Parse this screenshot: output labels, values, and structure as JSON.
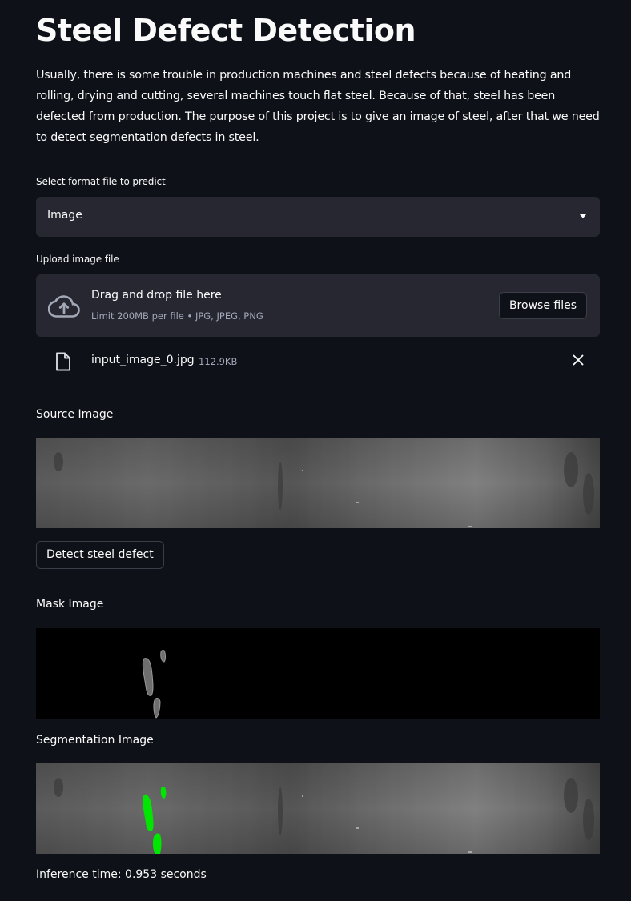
{
  "header": {
    "title": "Steel Defect Detection",
    "description": "Usually, there is some trouble in production machines and steel defects because of heating and rolling, drying and cutting, several machines touch flat steel. Because of that, steel has been defected from production. The purpose of this project is to give an image of steel, after that we need to detect segmentation defects in steel."
  },
  "format_select": {
    "label": "Select format file to predict",
    "value": "Image",
    "icon": "chevron-down-icon"
  },
  "uploader": {
    "label": "Upload image file",
    "drop_title": "Drag and drop file here",
    "limit_text": "Limit 200MB per file • JPG, JPEG, PNG",
    "browse_label": "Browse files",
    "icon": "cloud-upload-icon",
    "file": {
      "name": "input_image_0.jpg",
      "size": "112.9KB",
      "icon": "file-icon",
      "remove_icon": "close-icon"
    }
  },
  "source": {
    "caption": "Source Image"
  },
  "detect_button": {
    "label": "Detect steel defect"
  },
  "mask": {
    "caption": "Mask Image"
  },
  "segmentation": {
    "caption": "Segmentation Image",
    "highlight_color": "#00e600"
  },
  "result": {
    "inference_text": "Inference time: 0.953 seconds"
  },
  "colors": {
    "background": "#0e1117",
    "widget_background": "#262730",
    "text": "#fafafa",
    "muted_text": "#a3a8b8"
  }
}
